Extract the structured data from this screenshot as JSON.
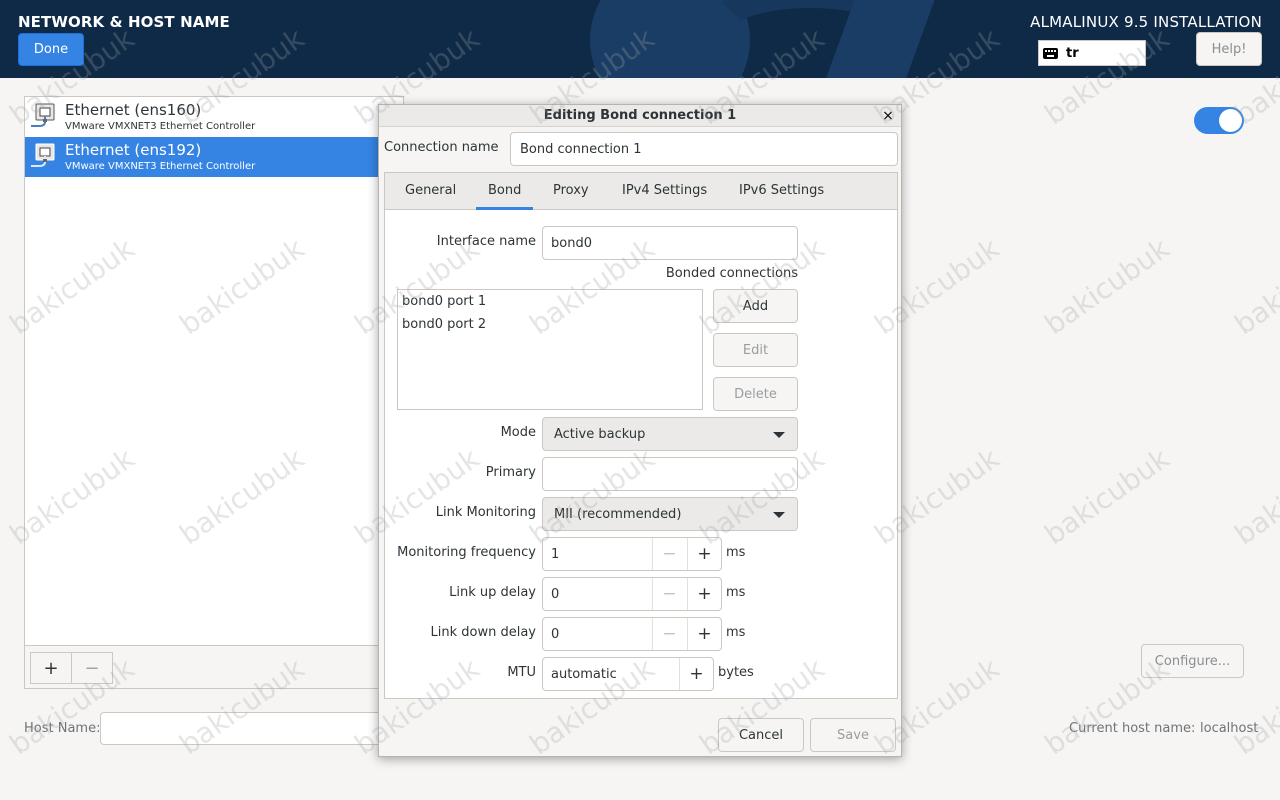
{
  "header": {
    "page_title": "NETWORK & HOST NAME",
    "done_label": "Done",
    "product_title": "ALMALINUX 9.5 INSTALLATION",
    "keyboard_layout": "tr",
    "help_label": "Help!"
  },
  "devices": [
    {
      "name": "Ethernet (ens160)",
      "description": "VMware VMXNET3 Ethernet Controller",
      "selected": false
    },
    {
      "name": "Ethernet (ens192)",
      "description": "VMware VMXNET3 Ethernet Controller",
      "selected": true
    }
  ],
  "list_toolbar": {
    "add": "+",
    "remove": "−"
  },
  "host": {
    "host_name_label": "Host Name:",
    "host_name_value": "",
    "current_label": "Current host name:",
    "current_value": "localhost"
  },
  "device_toggle_on": true,
  "configure_label": "Configure...",
  "dialog": {
    "title": "Editing Bond connection 1",
    "close": "×",
    "connection_name_label": "Connection name",
    "connection_name": "Bond connection 1",
    "tabs": [
      "General",
      "Bond",
      "Proxy",
      "IPv4 Settings",
      "IPv6 Settings"
    ],
    "active_tab": "Bond",
    "interface_name_label": "Interface name",
    "interface_name": "bond0",
    "bonded_connections_label": "Bonded connections",
    "bonded_connections": [
      "bond0 port 1",
      "bond0 port 2"
    ],
    "add_label": "Add",
    "edit_label": "Edit",
    "delete_label": "Delete",
    "mode_label": "Mode",
    "mode_value": "Active backup",
    "primary_label": "Primary",
    "primary_value": "",
    "link_monitoring_label": "Link Monitoring",
    "link_monitoring_value": "MII (recommended)",
    "monitoring_frequency_label": "Monitoring frequency",
    "monitoring_frequency": "1",
    "link_up_delay_label": "Link up delay",
    "link_up_delay": "0",
    "link_down_delay_label": "Link down delay",
    "link_down_delay": "0",
    "ms_unit": "ms",
    "mtu_label": "MTU",
    "mtu_value": "automatic",
    "bytes_unit": "bytes",
    "spin_minus": "−",
    "spin_plus": "+",
    "cancel_label": "Cancel",
    "save_label": "Save"
  },
  "watermark": "bakicubuk",
  "colors": {
    "header_bg": "#0f2a47",
    "accent": "#3584e4",
    "window_bg": "#f6f5f4"
  }
}
